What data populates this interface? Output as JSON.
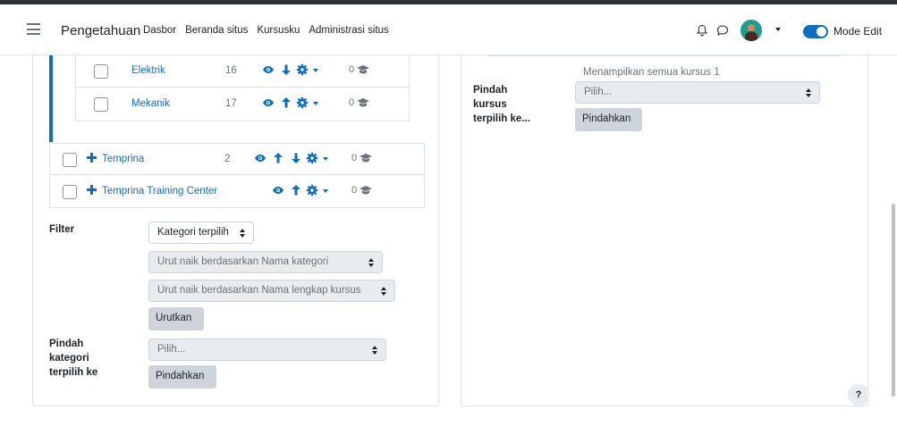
{
  "header": {
    "brand": "Pengetahuan",
    "nav": [
      "Dasbor",
      "Beranda situs",
      "Kursusku",
      "Administrasi situs"
    ],
    "edit_mode_label": "Mode Edit",
    "edit_mode_on": true
  },
  "categories": [
    {
      "name": "Elektrik",
      "count": "16",
      "courses": "0"
    },
    {
      "name": "Mekanik",
      "count": "17",
      "courses": "0"
    },
    {
      "name": "Temprina",
      "count": "2",
      "courses": "0"
    },
    {
      "name": "Temprina Training Center",
      "count": "",
      "courses": "0"
    }
  ],
  "filter": {
    "label": "Filter",
    "category_select": "Kategori terpilih",
    "sort_category": "Urut naik berdasarkan Nama kategori",
    "sort_course": "Urut naik berdasarkan Nama lengkap kursus",
    "sort_button": "Urutkan"
  },
  "move_category": {
    "label": "Pindah kategori terpilih ke",
    "placeholder": "Pilih...",
    "button": "Pindahkan"
  },
  "courses_panel": {
    "info": "Menampilkan semua kursus 1",
    "move_label": "Pindah kursus terpilih ke...",
    "placeholder": "Pilih...",
    "button": "Pindahkan"
  },
  "help": "?",
  "colors": {
    "accent": "#0f6cbf",
    "button_bg": "#ced4da",
    "border": "#dee2e6"
  }
}
